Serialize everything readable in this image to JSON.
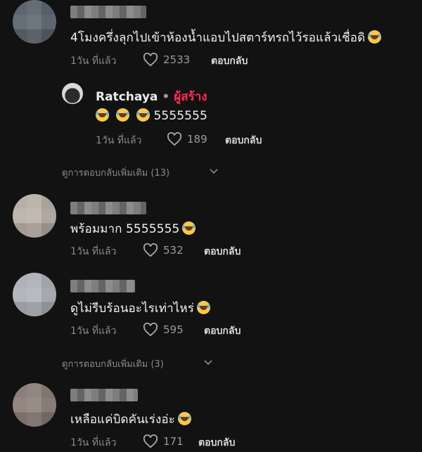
{
  "comments": [
    {
      "text": "4โมงครึ่งลุกไปเข้าห้องน้ำแอบไปสตาร์ทรถไว้รอแล้วเชื่อดิ",
      "emoji": "joy-emoji",
      "time": "1วัน ที่แล้ว",
      "likes": "2533",
      "reply_label": "ตอบกลับ"
    },
    {
      "text": "พร้อมมาก 5555555",
      "emoji": "joy-emoji",
      "time": "1วัน ที่แล้ว",
      "likes": "532",
      "reply_label": "ตอบกลับ"
    },
    {
      "text": "ดูไม่รีบร้อนอะไรเท่าไหร่",
      "emoji": "joy-emoji",
      "time": "1วัน ที่แล้ว",
      "likes": "595",
      "reply_label": "ตอบกลับ"
    },
    {
      "text": "เหลือแค่บิดคันเร่งอ่ะ",
      "emoji": "joy-emoji",
      "time": "1วัน ที่แล้ว",
      "likes": "171",
      "reply_label": "ตอบกลับ"
    }
  ],
  "creator_reply": {
    "name": "Ratchaya",
    "separator": "•",
    "badge": "ผู้สร้าง",
    "text": "5555555",
    "emoji_count": "3",
    "time": "1วัน ที่แล้ว",
    "likes": "189",
    "reply_label": "ตอบกลับ"
  },
  "view_more": [
    {
      "label": "ดูการตอบกลับเพิ่มเติม (13)"
    },
    {
      "label": "ดูการตอบกลับเพิ่มเติม (3)"
    }
  ],
  "icons": {
    "like": "heart-outline-icon",
    "expand": "chevron-down-icon",
    "emoji": "face-with-tears-of-joy"
  },
  "colors": {
    "background": "#121212",
    "creator_badge": "#fe2c55"
  }
}
